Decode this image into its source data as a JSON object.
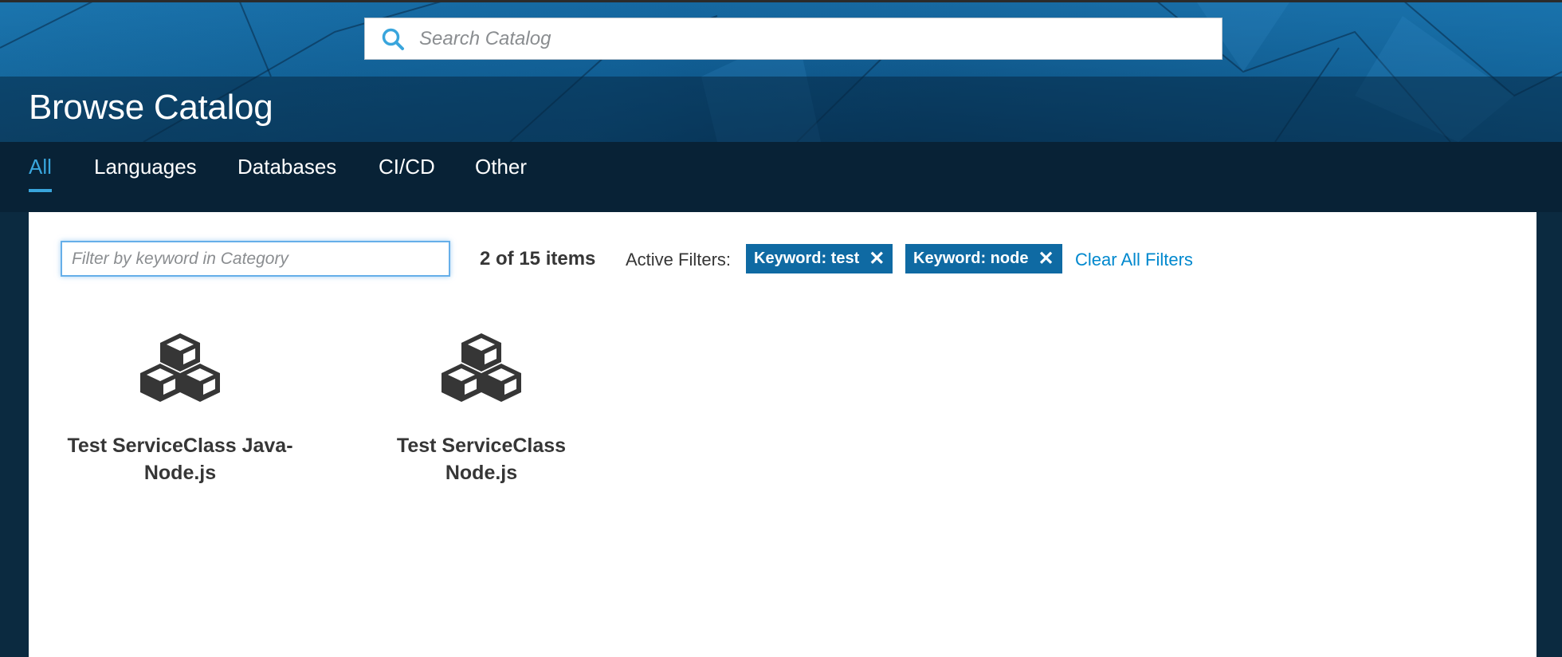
{
  "search": {
    "placeholder": "Search Catalog"
  },
  "header": {
    "title": "Browse Catalog"
  },
  "tabs": [
    {
      "label": "All",
      "active": true
    },
    {
      "label": "Languages"
    },
    {
      "label": "Databases"
    },
    {
      "label": "CI/CD"
    },
    {
      "label": "Other"
    }
  ],
  "filter": {
    "placeholder": "Filter by keyword in Category",
    "count_text": "2 of 15 items",
    "active_label": "Active Filters:",
    "chips": [
      {
        "label": "Keyword: test",
        "remove_icon": "close-icon"
      },
      {
        "label": "Keyword: node",
        "remove_icon": "close-icon"
      }
    ],
    "clear_label": "Clear All Filters"
  },
  "items": [
    {
      "title": "Test ServiceClass Java-Node.js",
      "icon": "cubes-icon"
    },
    {
      "title": "Test ServiceClass Node.js",
      "icon": "cubes-icon"
    }
  ],
  "colors": {
    "accent": "#39a5dc",
    "chip": "#0f6aa3",
    "link": "#0088ce",
    "nav_bg": "#082236"
  }
}
